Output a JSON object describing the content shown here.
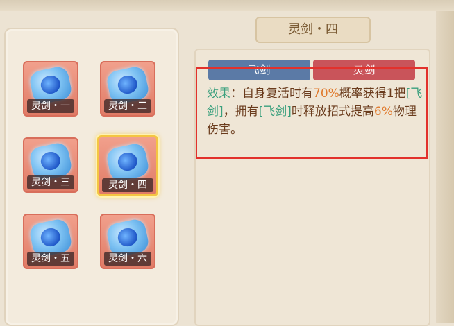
{
  "title": "灵剑・四",
  "tabs": [
    {
      "label": "飞剑"
    },
    {
      "label": "灵剑"
    }
  ],
  "slots": [
    {
      "label": "灵剑・一",
      "selected": false
    },
    {
      "label": "灵剑・二",
      "selected": false
    },
    {
      "label": "灵剑・三",
      "selected": false
    },
    {
      "label": "灵剑・四",
      "selected": true
    },
    {
      "label": "灵剑・五",
      "selected": false
    },
    {
      "label": "灵剑・六",
      "selected": false
    }
  ],
  "description": {
    "prefix": "效果",
    "colon": "：",
    "t1": "自身复活时有",
    "pct1": "70%",
    "t2": "概率获得1把",
    "link1": "[飞剑]",
    "t3": "，拥有",
    "link2": "[飞剑]",
    "t4": "时释放招式提高",
    "pct2": "6%",
    "t5": "物理伤害。"
  },
  "colors": {
    "highlight_box": "#e2312c",
    "tab_fly": "#5b7aa6",
    "tab_spirit": "#c9545a",
    "selected_border": "#f4c542"
  }
}
